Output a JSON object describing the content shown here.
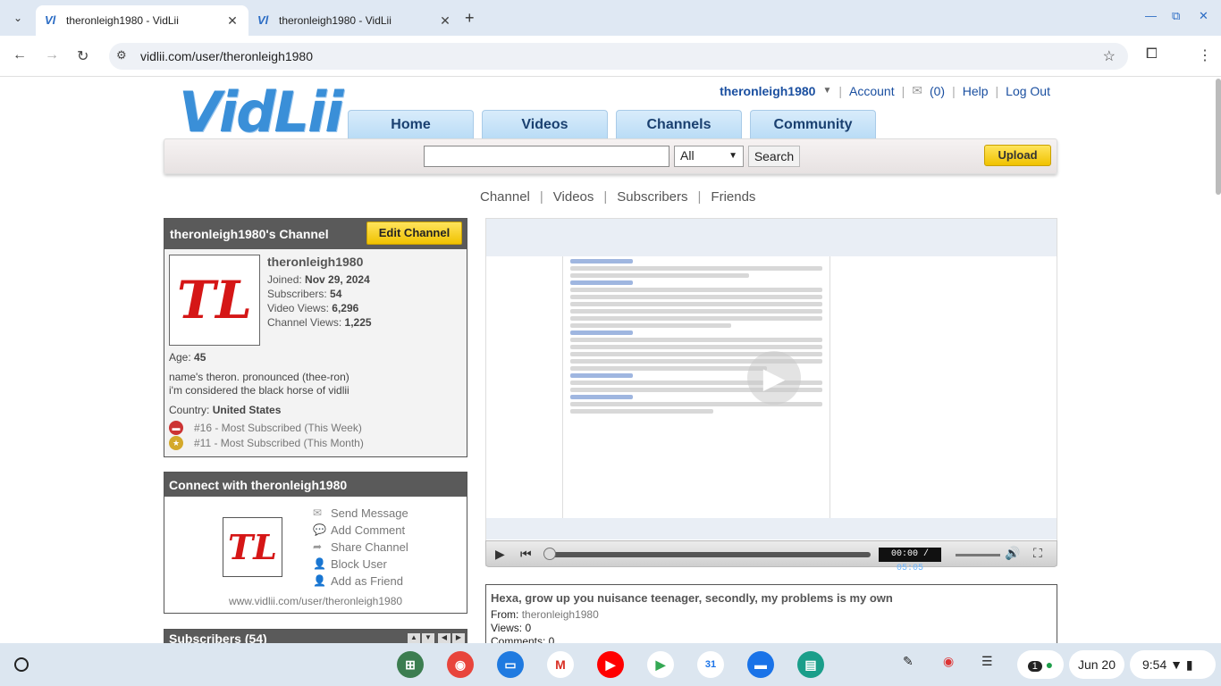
{
  "browser": {
    "tabs": [
      {
        "title": "theronleigh1980 - VidLii",
        "active": true
      },
      {
        "title": "theronleigh1980 - VidLii",
        "active": false
      }
    ],
    "url": "vidlii.com/user/theronleigh1980",
    "favicon": "Vl"
  },
  "site": {
    "logo": "VidLii",
    "user": {
      "username": "theronleigh1980",
      "account": "Account",
      "inbox_count": "(0)",
      "help": "Help",
      "logout": "Log Out"
    },
    "nav": [
      "Home",
      "Videos",
      "Channels",
      "Community"
    ],
    "search": {
      "value": "",
      "scope": "All",
      "button": "Search",
      "upload": "Upload"
    },
    "subnav": [
      "Channel",
      "Videos",
      "Subscribers",
      "Friends"
    ]
  },
  "channel": {
    "header": "theronleigh1980's Channel",
    "edit_button": "Edit Channel",
    "avatar_text": "TL",
    "name": "theronleigh1980",
    "joined_label": "Joined:",
    "joined": "Nov 29, 2024",
    "subscribers_label": "Subscribers:",
    "subscribers": "54",
    "video_views_label": "Video Views:",
    "video_views": "6,296",
    "channel_views_label": "Channel Views:",
    "channel_views": "1,225",
    "age_label": "Age:",
    "age": "45",
    "bio_line1": "name's theron. pronounced (thee-ron)",
    "bio_line2": "i'm considered the black horse of vidlii",
    "country_label": "Country:",
    "country": "United States",
    "awards": [
      "#16 - Most Subscribed (This Week)",
      "#11 - Most Subscribed (This Month)"
    ]
  },
  "connect": {
    "header": "Connect with theronleigh1980",
    "actions": [
      "Send Message",
      "Add Comment",
      "Share Channel",
      "Block User",
      "Add as Friend"
    ],
    "url": "www.vidlii.com/user/theronleigh1980"
  },
  "subscribers_box": {
    "header": "Subscribers (54)"
  },
  "player": {
    "time_current": "00:00",
    "time_total": "05:05"
  },
  "video": {
    "title": "Hexa, grow up you nuisance teenager, secondly, my problems is my own",
    "from_label": "From:",
    "from": "theronleigh1980",
    "views": "Views: 0",
    "comments": "Comments: 0"
  },
  "shelf": {
    "date": "Jun 20",
    "time": "9:54",
    "notif_count": "1"
  },
  "colors": {
    "accent": "#1a4fa0",
    "logo": "#3a8fd8",
    "upload": "#f0c200",
    "avatar": "#d51616"
  }
}
